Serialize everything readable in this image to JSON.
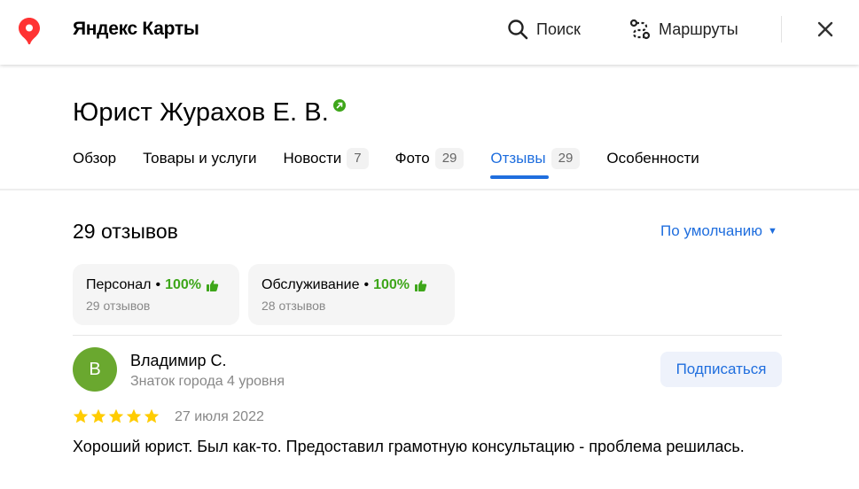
{
  "header": {
    "app_title": "Яндекс Карты",
    "search_label": "Поиск",
    "routes_label": "Маршруты"
  },
  "org": {
    "title": "Юрист Журахов Е. В."
  },
  "tabs": [
    {
      "label": "Обзор",
      "badge": ""
    },
    {
      "label": "Товары и услуги",
      "badge": ""
    },
    {
      "label": "Новости",
      "badge": "7"
    },
    {
      "label": "Фото",
      "badge": "29"
    },
    {
      "label": "Отзывы",
      "badge": "29",
      "active": true
    },
    {
      "label": "Особенности",
      "badge": ""
    }
  ],
  "reviews": {
    "count_label": "29 отзывов",
    "sort_label": "По умолчанию",
    "aspects": [
      {
        "name": "Персонал",
        "percent": "100%",
        "count": "29 отзывов"
      },
      {
        "name": "Обслуживание",
        "percent": "100%",
        "count": "28 отзывов"
      }
    ],
    "items": [
      {
        "avatar_letter": "В",
        "author": "Владимир С.",
        "level": "Знаток города 4 уровня",
        "subscribe_label": "Подписаться",
        "rating": 5,
        "date": "27 июля 2022",
        "text": "Хороший юрист. Был как-то. Предоставил грамотную консультацию - проблема решилась."
      }
    ]
  },
  "colors": {
    "accent": "#1f6ede",
    "positive": "#3ea61a",
    "star": "#fc0",
    "avatar": "#6aa82f",
    "logo": "#f33"
  }
}
